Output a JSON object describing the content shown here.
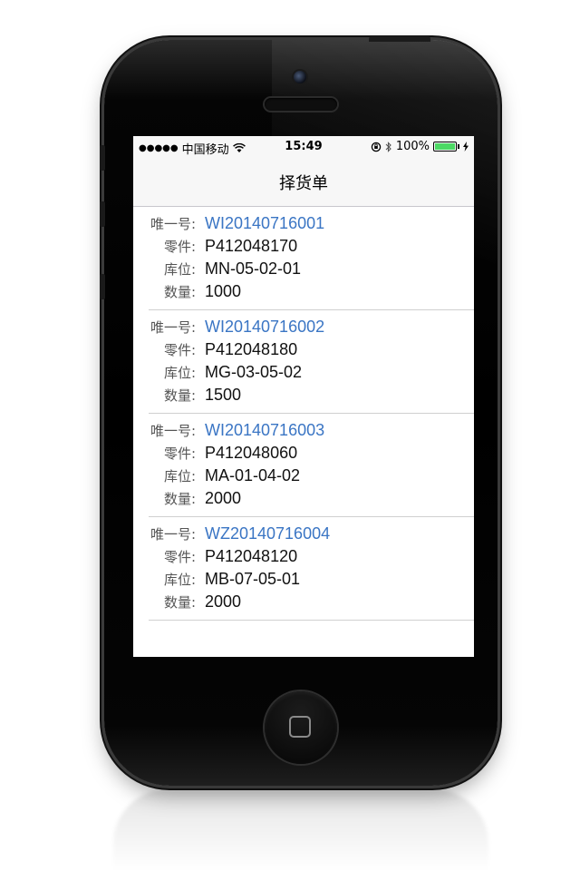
{
  "status_bar": {
    "signal_dots": "●●●●●",
    "carrier": "中国移动",
    "wifi_icon": "wifi-icon",
    "time": "15:49",
    "rotation_lock_icon": "rotation-lock-icon",
    "bluetooth_icon": "bluetooth-icon",
    "battery_percent": "100%",
    "battery_level": 1.0,
    "charging_icon": "bolt-icon"
  },
  "nav": {
    "title": "择货单"
  },
  "labels": {
    "id": "唯一号:",
    "part": "零件:",
    "location": "库位:",
    "quantity": "数量:"
  },
  "items": [
    {
      "id": "WI20140716001",
      "part": "P412048170",
      "location": "MN-05-02-01",
      "quantity": "1000"
    },
    {
      "id": "WI20140716002",
      "part": "P412048180",
      "location": "MG-03-05-02",
      "quantity": "1500"
    },
    {
      "id": "WI20140716003",
      "part": "P412048060",
      "location": "MA-01-04-02",
      "quantity": "2000"
    },
    {
      "id": "WZ20140716004",
      "part": "P412048120",
      "location": "MB-07-05-01",
      "quantity": "2000"
    }
  ],
  "colors": {
    "link": "#3a75c4",
    "battery": "#4cd964",
    "separator": "#d0d0d0"
  }
}
